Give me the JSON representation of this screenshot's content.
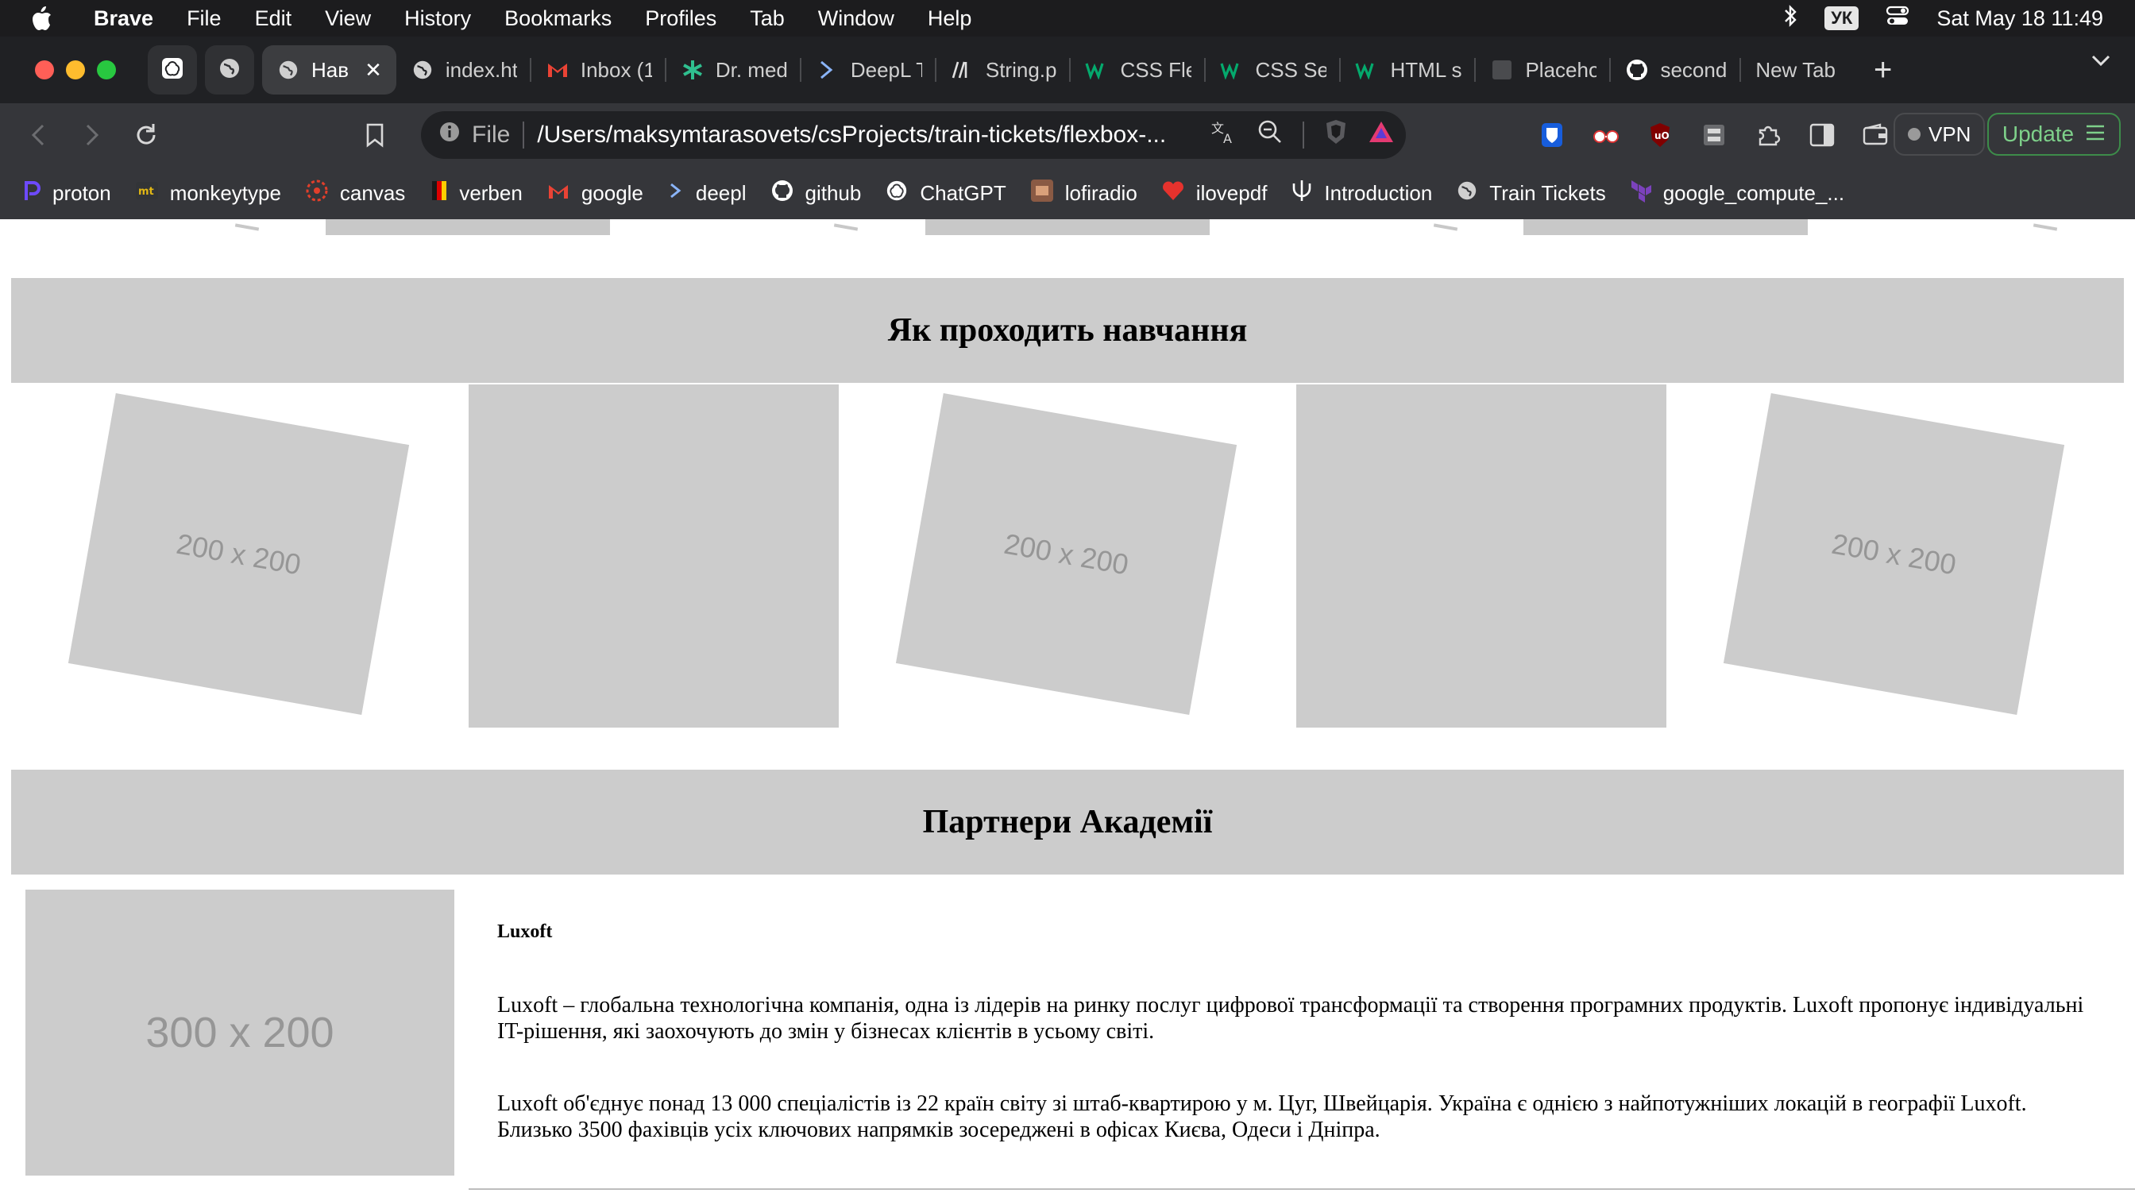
{
  "menubar": {
    "app": "Brave",
    "items": [
      "File",
      "Edit",
      "View",
      "History",
      "Bookmarks",
      "Profiles",
      "Tab",
      "Window",
      "Help"
    ],
    "keyboard_layout": "УК",
    "datetime": "Sat May 18  11:49"
  },
  "tabs": [
    {
      "title": "Нав",
      "icon": "globe-icon",
      "active": true
    },
    {
      "title": "index.ht",
      "icon": "globe-icon"
    },
    {
      "title": "Inbox (1",
      "icon": "gmail-icon"
    },
    {
      "title": "Dr. med",
      "icon": "asterisk-icon"
    },
    {
      "title": "DeepL T",
      "icon": "deepl-icon"
    },
    {
      "title": "String.p",
      "icon": "mdn-icon"
    },
    {
      "title": "CSS Fle",
      "icon": "w3schools-icon"
    },
    {
      "title": "CSS Sel",
      "icon": "w3schools-icon"
    },
    {
      "title": "HTML s",
      "icon": "w3schools-icon"
    },
    {
      "title": "Placeho",
      "icon": "placeholder-icon"
    },
    {
      "title": "second",
      "icon": "github-icon"
    },
    {
      "title": "New Tab",
      "icon": "none"
    }
  ],
  "omnibox": {
    "scheme": "File",
    "url": "/Users/maksymtarasovets/csProjects/train-tickets/flexbox-..."
  },
  "toolbar": {
    "vpn_label": "VPN",
    "update_label": "Update"
  },
  "bookmarks": [
    {
      "label": "proton",
      "icon": "proton-icon",
      "color": "#6d4aff"
    },
    {
      "label": "monkeytype",
      "icon": "monkeytype-icon",
      "color": "#e2b714"
    },
    {
      "label": "canvas",
      "icon": "canvas-icon",
      "color": "#e13f2b"
    },
    {
      "label": "verben",
      "icon": "verben-icon",
      "color": "#f5c518"
    },
    {
      "label": "google",
      "icon": "gmail-icon",
      "color": "#ea4335"
    },
    {
      "label": "deepl",
      "icon": "deepl-icon",
      "color": "#0f2b46"
    },
    {
      "label": "github",
      "icon": "github-icon",
      "color": "#ffffff"
    },
    {
      "label": "ChatGPT",
      "icon": "chatgpt-icon",
      "color": "#ffffff"
    },
    {
      "label": "lofiradio",
      "icon": "lofiradio-icon",
      "color": "#8a5a44"
    },
    {
      "label": "ilovepdf",
      "icon": "ilovepdf-icon",
      "color": "#e5322d"
    },
    {
      "label": "Introduction",
      "icon": "psi-icon",
      "color": "#ffffff"
    },
    {
      "label": "Train Tickets",
      "icon": "globe-icon",
      "color": "#cccccc"
    },
    {
      "label": "google_compute_...",
      "icon": "terraform-icon",
      "color": "#7b42bc"
    }
  ],
  "page": {
    "section_learning": {
      "title": "Як проходить навчання",
      "placeholder_label": "200 x 200"
    },
    "section_partners": {
      "title": "Партнери Академії",
      "image_label": "300 x 200",
      "partner_name": "Luxoft",
      "paragraph_1": "Luxoft – глобальна технологічна компанія, одна із лідерів на ринку послуг цифрової трансформації та створення програмних продуктів. Luxoft пропонує індивідуальні IT-рішення, які заохочують до змін у бізнесах клієнтів в усьому світі.",
      "paragraph_2": "Luxoft об'єднує понад 13 000 спеціалістів із 22 країн світу зі штаб-квартирою у м. Цуг, Швейцарія. Україна є однією з найпотужніших локацій в географії Luxoft. Близько 3500 фахівців усіх ключових напрямків зосереджені в офісах Києва, Одеси і Дніпра."
    }
  }
}
